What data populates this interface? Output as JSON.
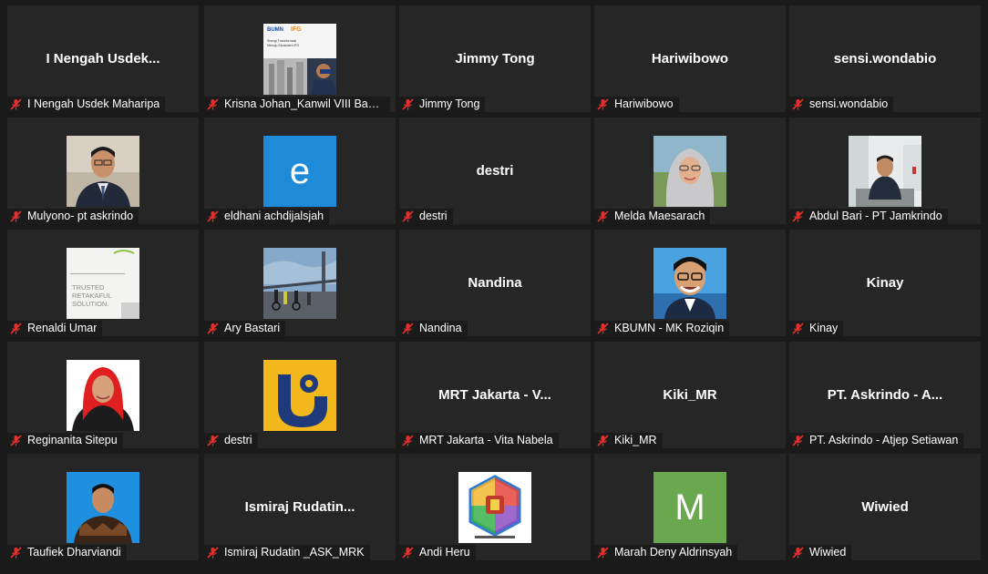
{
  "colors": {
    "background": "#1a1a1a",
    "tile": "#262626",
    "muted_mic": "#e0312f"
  },
  "participants": [
    {
      "center": "I  Nengah  Usdek...",
      "label": "I Nengah Usdek Maharipa",
      "type": "text"
    },
    {
      "label": "Krisna Johan_Kanwil VIII Banja...",
      "type": "slide",
      "thumb_text": [
        "BUMN",
        "IFG",
        "Sinergi Transformasi",
        "Menuju Ekosistem IFG"
      ]
    },
    {
      "center": "Jimmy Tong",
      "label": "Jimmy Tong",
      "type": "text"
    },
    {
      "center": "Hariwibowo",
      "label": "Hariwibowo",
      "type": "text"
    },
    {
      "center": "sensi.wondabio",
      "label": "sensi.wondabio",
      "type": "text"
    },
    {
      "label": "Mulyono- pt askrindo",
      "type": "photo-man-suit"
    },
    {
      "label": "eldhani achdijalsjah",
      "type": "letter",
      "letter": "e",
      "letter_bg": "#1f8ad8"
    },
    {
      "center": "destri",
      "label": "destri",
      "type": "text"
    },
    {
      "label": "Melda Maesarach",
      "type": "photo-hijab"
    },
    {
      "label": "Abdul Bari - PT Jamkrindo",
      "type": "photo-office"
    },
    {
      "label": "Renaldi Umar",
      "type": "retakaful",
      "thumb_text": [
        "TRUSTED",
        "RETAKAFUL",
        "SOLUTION."
      ]
    },
    {
      "label": "Ary Bastari",
      "type": "photo-bridge"
    },
    {
      "center": "Nandina",
      "label": "Nandina",
      "type": "text"
    },
    {
      "label": "KBUMN - MK Roziqin",
      "type": "caricature"
    },
    {
      "center": "Kinay",
      "label": "Kinay",
      "type": "text"
    },
    {
      "label": "Reginanita Sitepu",
      "type": "photo-red-hijab"
    },
    {
      "label": "destri",
      "type": "logo-pu"
    },
    {
      "center": "MRT  Jakarta  -  V...",
      "label": "MRT Jakarta - Vita Nabela",
      "type": "text"
    },
    {
      "center": "Kiki_MR",
      "label": "Kiki_MR",
      "type": "text"
    },
    {
      "center": "PT.  Askrindo  -  A...",
      "label": "PT. Askrindo - Atjep Setiawan",
      "type": "text"
    },
    {
      "label": "Taufiek Dharviandi",
      "type": "photo-batik"
    },
    {
      "center": "Ismiraj  Rudatin...",
      "label": "Ismiraj Rudatin _ASK_MRK",
      "type": "text"
    },
    {
      "label": "Andi Heru",
      "type": "hexlogo"
    },
    {
      "label": "Marah Deny Aldrinsyah",
      "type": "letter",
      "letter": "M",
      "letter_bg": "#6aa84f"
    },
    {
      "center": "Wiwied",
      "label": "Wiwied",
      "type": "text"
    }
  ]
}
